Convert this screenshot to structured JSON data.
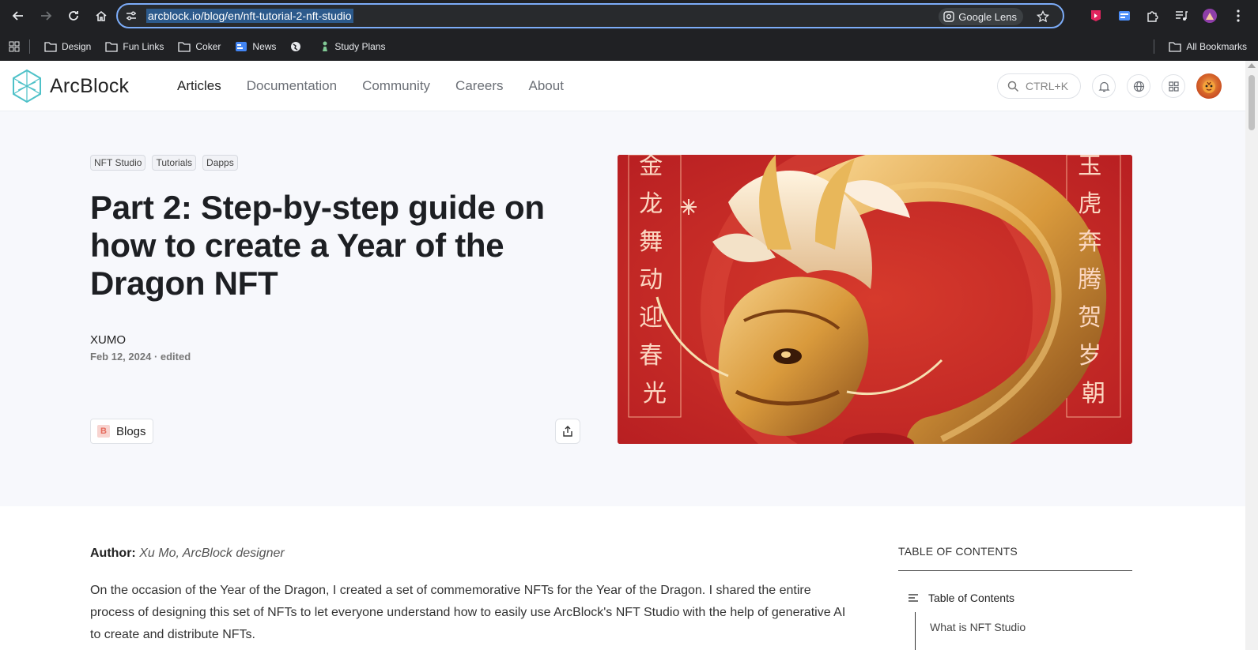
{
  "browser": {
    "url": "arcblock.io/blog/en/nft-tutorial-2-nft-studio",
    "lens_label": "Google Lens",
    "bookmarks": [
      {
        "label": "Design",
        "icon": "folder-icon"
      },
      {
        "label": "Fun Links",
        "icon": "folder-icon"
      },
      {
        "label": "Coker",
        "icon": "folder-icon"
      },
      {
        "label": "News",
        "icon": "google-news-icon"
      },
      {
        "label": "",
        "icon": "globe-icon"
      },
      {
        "label": "Study Plans",
        "icon": "chess-pawn-icon"
      }
    ],
    "all_bookmarks_label": "All Bookmarks"
  },
  "header": {
    "logo_text": "ArcBlock",
    "nav": [
      {
        "label": "Articles",
        "active": true
      },
      {
        "label": "Documentation",
        "active": false
      },
      {
        "label": "Community",
        "active": false
      },
      {
        "label": "Careers",
        "active": false
      },
      {
        "label": "About",
        "active": false
      }
    ],
    "search_placeholder": "CTRL+K"
  },
  "hero": {
    "tags": [
      "NFT Studio",
      "Tutorials",
      "Dapps"
    ],
    "title": "Part 2: Step-by-step guide on how to create a Year of the Dragon NFT",
    "author": "XUMO",
    "date": "Feb 12, 2024 · edited",
    "blog_label": "Blogs",
    "blog_badge": "B",
    "image_left_text": "金龙舞动迎春光",
    "image_right_text": "玉虎奔腾贺岁朝"
  },
  "article": {
    "author_prefix": "Author:",
    "author_value": "Xu Mo, ArcBlock designer",
    "intro": "On the occasion of the Year of the Dragon, I created a set of commemorative NFTs for the Year of the Dragon. I shared the entire process of designing this set of NFTs to let everyone understand how to easily use ArcBlock's NFT Studio with the help of generative AI to create and distribute NFTs."
  },
  "toc": {
    "heading": "TABLE OF CONTENTS",
    "title": "Table of Contents",
    "items": [
      "What is NFT Studio"
    ]
  },
  "colors": {
    "accent": "#7cacf8",
    "hero_bg": "#f7f8fc",
    "image_red": "#c8282a",
    "gold": "#e3a94a"
  }
}
